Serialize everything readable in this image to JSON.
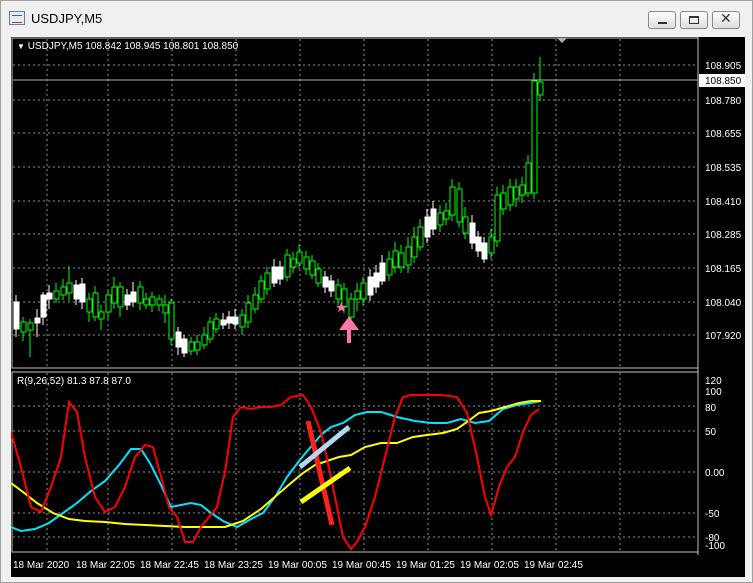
{
  "window": {
    "title": "USDJPY,M5",
    "icon": "chart-window-icon",
    "controls": [
      "minimize-icon",
      "maximize-icon",
      "close-icon"
    ]
  },
  "main_chart": {
    "symbol_info": "USDJPY,M5  108.842 108.945 108.801 108.850",
    "price_labels": [
      "108.905",
      "108.780",
      "108.655",
      "108.535",
      "108.410",
      "108.285",
      "108.165",
      "108.040",
      "107.920"
    ],
    "current_price": "108.850",
    "colors": {
      "background": "#000000",
      "bull": "#00ff00",
      "bear": "#ffffff",
      "grid": "#c0c0c0",
      "marker": "#ff77aa"
    }
  },
  "indicator": {
    "label": "R(9,26,52) 81.3 87.8 87.0",
    "levels": [
      "120",
      "100",
      "80",
      "50",
      "0.00",
      "-50",
      "-80",
      "-100"
    ],
    "colors": {
      "fast": "#ff0000",
      "mid": "#00e5ff",
      "slow": "#ffff00"
    }
  },
  "time_axis": [
    "18 Mar 2020",
    "18 Mar 22:05",
    "18 Mar 22:45",
    "18 Mar 23:25",
    "19 Mar 00:05",
    "19 Mar 00:45",
    "19 Mar 01:25",
    "19 Mar 02:05",
    "19 Mar 02:45"
  ],
  "annotations": {
    "star": "★",
    "arrow": "up-arrow"
  }
}
